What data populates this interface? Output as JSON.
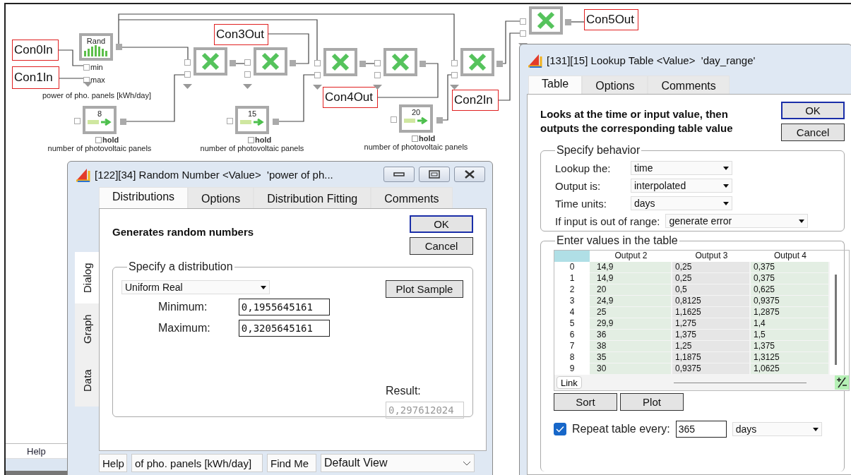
{
  "diagram": {
    "connectors": [
      {
        "label": "Con0In"
      },
      {
        "label": "Con1In"
      },
      {
        "label": "Con3Out"
      },
      {
        "label": "Con4Out"
      },
      {
        "label": "Con2In"
      },
      {
        "label": "Con5Out"
      }
    ],
    "nodes": [
      {
        "kind": "random",
        "label": "Rand",
        "ports": [
          "min",
          "max"
        ],
        "caption": "power of pho. panels [kWh/day]"
      },
      {
        "kind": "multiply"
      },
      {
        "kind": "multiply"
      },
      {
        "kind": "multiply"
      },
      {
        "kind": "multiply"
      },
      {
        "kind": "multiply"
      },
      {
        "kind": "multiply"
      },
      {
        "kind": "constant",
        "value": "8",
        "hold_label": "hold",
        "hold_checked": false,
        "caption": "number of photovoltaic panels"
      },
      {
        "kind": "constant",
        "value": "15",
        "hold_label": "hold",
        "hold_checked": false,
        "caption": "number of photovoltaic panels"
      },
      {
        "kind": "constant",
        "value": "20",
        "hold_label": "hold",
        "hold_checked": false,
        "caption": "number of photovoltaic panels"
      }
    ]
  },
  "background_tab": "Help",
  "random_dialog": {
    "title": "[122][34] Random Number <Value>  'power of ph...",
    "tabs": [
      {
        "label": "Distributions",
        "selected": true
      },
      {
        "label": "Options",
        "selected": false
      },
      {
        "label": "Distribution Fitting",
        "selected": false
      },
      {
        "label": "Comments",
        "selected": false
      }
    ],
    "side_tabs": [
      {
        "label": "Dialog",
        "selected": true
      },
      {
        "label": "Graph",
        "selected": false
      },
      {
        "label": "Data",
        "selected": false
      }
    ],
    "heading": "Generates random numbers",
    "ok": "OK",
    "cancel": "Cancel",
    "group_title": "Specify a distribution",
    "distribution": "Uniform Real",
    "fields": [
      {
        "label": "Minimum:",
        "value": "0,1955645161"
      },
      {
        "label": "Maximum:",
        "value": "0,3205645161"
      }
    ],
    "plot_button": "Plot Sample",
    "result_label": "Result:",
    "result_value": "0,297612024",
    "footer": {
      "help": "Help",
      "name": "of pho. panels [kWh/day]",
      "find": "Find Me",
      "view": "Default View"
    }
  },
  "lookup_dialog": {
    "title": "[131][15] Lookup Table <Value>  'day_range'",
    "tabs": [
      {
        "label": "Table",
        "selected": true
      },
      {
        "label": "Options",
        "selected": false
      },
      {
        "label": "Comments",
        "selected": false
      }
    ],
    "heading": "Looks at the time or input value, then outputs the corresponding table value",
    "ok": "OK",
    "cancel": "Cancel",
    "behavior_title": "Specify behavior",
    "behavior": [
      {
        "label": "Lookup the:",
        "value": "time"
      },
      {
        "label": "Output is:",
        "value": "interpolated"
      },
      {
        "label": "Time units:",
        "value": "days"
      },
      {
        "label": "If input is out of range:",
        "value": "generate error"
      }
    ],
    "table_title": "Enter values in the table",
    "table": {
      "columns": [
        "Output 2",
        "Output 3",
        "Output 4"
      ],
      "rows": [
        {
          "index": "0",
          "cells": [
            "14,9",
            "0,25",
            "0,375"
          ]
        },
        {
          "index": "1",
          "cells": [
            "14,9",
            "0,25",
            "0,375"
          ]
        },
        {
          "index": "2",
          "cells": [
            "20",
            "0,5",
            "0,625"
          ]
        },
        {
          "index": "3",
          "cells": [
            "24,9",
            "0,8125",
            "0,9375"
          ]
        },
        {
          "index": "4",
          "cells": [
            "25",
            "1,1625",
            "1,2875"
          ]
        },
        {
          "index": "5",
          "cells": [
            "29,9",
            "1,275",
            "1,4"
          ]
        },
        {
          "index": "6",
          "cells": [
            "36",
            "1,375",
            "1,5"
          ]
        },
        {
          "index": "7",
          "cells": [
            "38",
            "1,25",
            "1,375"
          ]
        },
        {
          "index": "8",
          "cells": [
            "35",
            "1,1875",
            "1,3125"
          ]
        },
        {
          "index": "9",
          "cells": [
            "30",
            "0,9375",
            "1,0625"
          ]
        }
      ],
      "link": "Link"
    },
    "sort": "Sort",
    "plot": "Plot",
    "repeat": {
      "checked": true,
      "label": "Repeat table every:",
      "value": "365",
      "unit": "days"
    }
  }
}
